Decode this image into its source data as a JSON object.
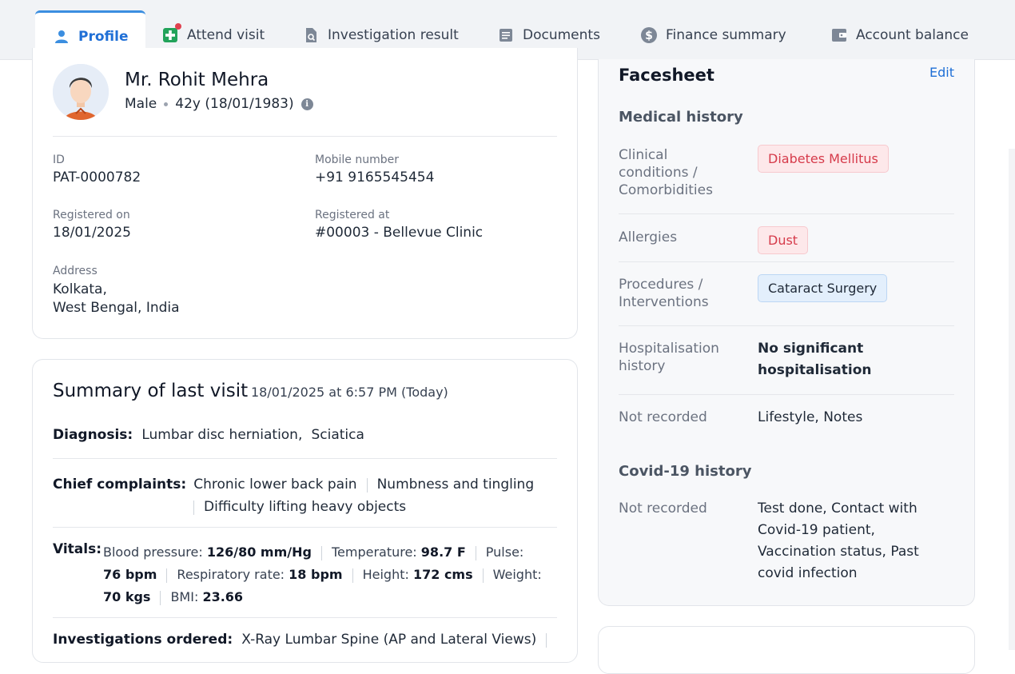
{
  "tabs": [
    {
      "label": "Profile",
      "icon": "person-icon"
    },
    {
      "label": "Attend visit",
      "icon": "medical-plus-icon"
    },
    {
      "label": "Investigation result",
      "icon": "search-document-icon"
    },
    {
      "label": "Documents",
      "icon": "document-icon"
    },
    {
      "label": "Finance summary",
      "icon": "dollar-icon"
    },
    {
      "label": "Account balance",
      "icon": "wallet-icon"
    }
  ],
  "colors": {
    "accent": "#1f6fd6",
    "notification": "#e0414f",
    "chip_red": "#d63b4b",
    "chip_blue_bg": "#e3effc"
  },
  "patient": {
    "name": "Mr. Rohit Mehra",
    "gender": "Male",
    "age": "42y (18/01/1983)",
    "id_label": "ID",
    "id": "PAT-0000782",
    "mobile_label": "Mobile number",
    "mobile": "+91 9165545454",
    "registered_on_label": "Registered on",
    "registered_on": "18/01/2025",
    "registered_at_label": "Registered at",
    "registered_at": "#00003 - Bellevue Clinic",
    "address_label": "Address",
    "address_line1": "Kolkata,",
    "address_line2": "West Bengal, India"
  },
  "summary": {
    "title": "Summary of last visit",
    "date": "18/01/2025 at 6:57 PM (Today)",
    "diagnosis_label": "Diagnosis:",
    "diagnosis": [
      "Lumbar disc herniation,",
      "Sciatica"
    ],
    "complaints_label": "Chief complaints:",
    "complaints": [
      "Chronic lower back pain",
      "Numbness and tingling",
      "Difficulty lifting heavy objects"
    ],
    "vitals_label": "Vitals:",
    "vitals": [
      {
        "k": "Blood pressure:",
        "v": "126/80 mm/Hg"
      },
      {
        "k": "Temperature:",
        "v": "98.7 F"
      },
      {
        "k": "Pulse:",
        "v": "76 bpm"
      },
      {
        "k": "Respiratory rate:",
        "v": "18 bpm"
      },
      {
        "k": "Height:",
        "v": "172 cms"
      },
      {
        "k": "Weight:",
        "v": "70 kgs"
      },
      {
        "k": "BMI:",
        "v": "23.66"
      }
    ],
    "investigations_label": "Investigations ordered:",
    "investigations": [
      "X-Ray Lumbar Spine (AP and Lateral Views)"
    ]
  },
  "facesheet": {
    "title": "Facesheet",
    "edit": "Edit",
    "medical_history_title": "Medical history",
    "clinical_label": "Clinical conditions / Comorbidities",
    "clinical_chip": "Diabetes Mellitus",
    "allergies_label": "Allergies",
    "allergies_chip": "Dust",
    "procedures_label": "Procedures / Interventions",
    "procedures_chip": "Cataract Surgery",
    "hospitalisation_label": "Hospitalisation history",
    "hospitalisation_value": "No significant hospitalisation",
    "not_recorded_label": "Not recorded",
    "not_recorded_value": "Lifestyle, Notes",
    "covid_title": "Covid-19 history",
    "covid_not_recorded_label": "Not recorded",
    "covid_not_recorded_value": "Test done, Contact with Covid-19 patient, Vaccination status, Past covid infection"
  }
}
